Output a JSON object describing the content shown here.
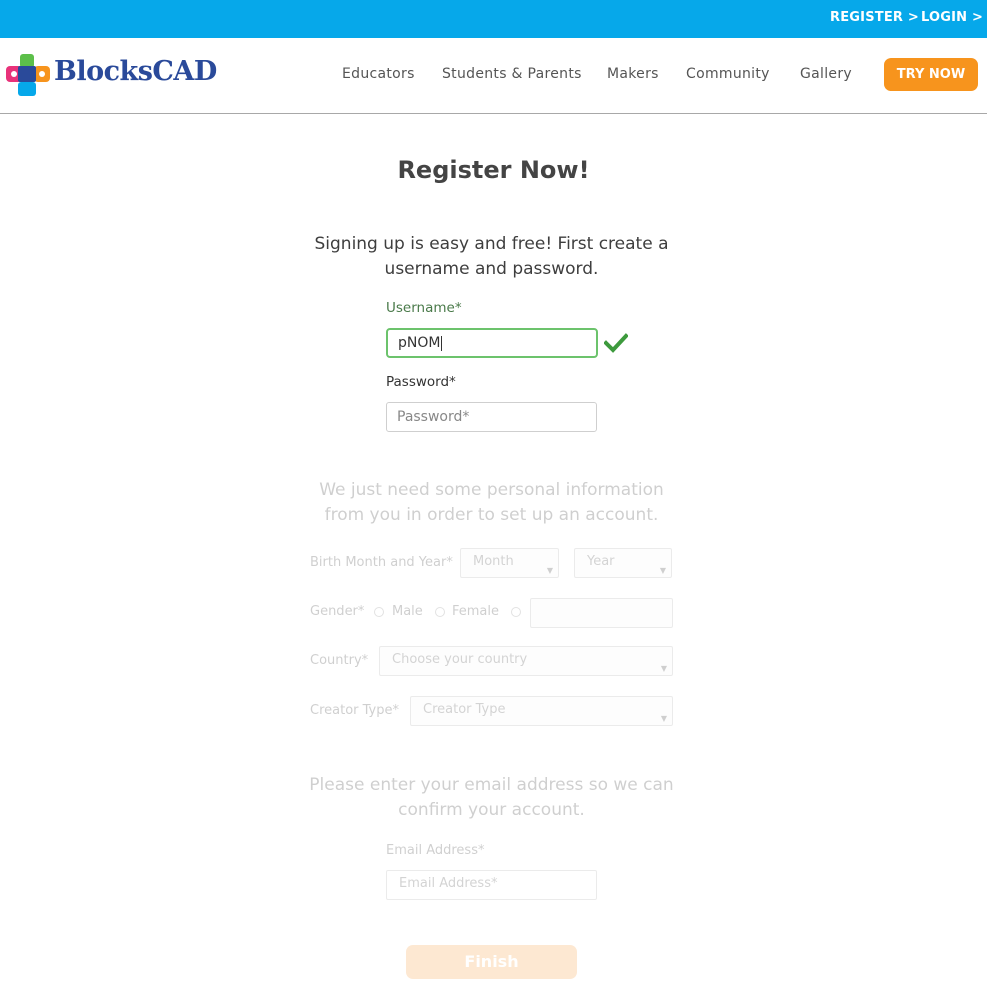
{
  "topbar": {
    "register": "REGISTER >",
    "login": "LOGIN >"
  },
  "brand": {
    "name": "BlocksCAD"
  },
  "nav": {
    "items": [
      "Educators",
      "Students & Parents",
      "Makers",
      "Community",
      "Gallery"
    ],
    "cta": "TRY NOW"
  },
  "form": {
    "title": "Register Now!",
    "intro": "Signing up is easy and free! First create a username and password.",
    "username_label": "Username*",
    "username_value": "pNOM",
    "password_label": "Password*",
    "password_placeholder": "Password*",
    "personal_intro": "We just need some personal information from you in order to set up an account.",
    "birth_label": "Birth Month and Year*",
    "month_placeholder": "Month",
    "year_placeholder": "Year",
    "gender_label": "Gender*",
    "gender_male": "Male",
    "gender_female": "Female",
    "country_label": "Country*",
    "country_placeholder": "Choose your country",
    "creator_label": "Creator Type*",
    "creator_placeholder": "Creator Type",
    "email_intro": "Please enter your email address so we can confirm your account.",
    "email_label": "Email Address*",
    "email_placeholder": "Email Address*",
    "finish": "Finish"
  },
  "colors": {
    "topbar": "#06a8ea",
    "cta": "#f7941d",
    "valid": "#3d9a3d",
    "logo_text": "#2a4a9a"
  }
}
